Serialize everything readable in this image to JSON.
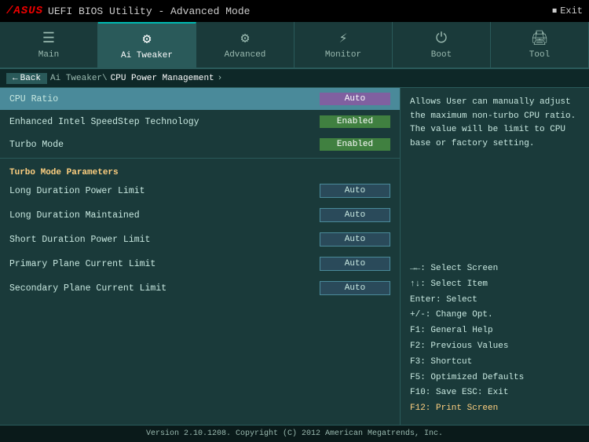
{
  "topbar": {
    "logo": "/ASUS",
    "title": "UEFI BIOS Utility - Advanced Mode",
    "exit_label": "Exit"
  },
  "tabs": [
    {
      "id": "main",
      "label": "Main",
      "icon": "≡",
      "active": false
    },
    {
      "id": "ai-tweaker",
      "label": "Ai Tweaker",
      "icon": "⚙",
      "active": true
    },
    {
      "id": "advanced",
      "label": "Advanced",
      "icon": "⚙",
      "active": false
    },
    {
      "id": "monitor",
      "label": "Monitor",
      "icon": "⚡",
      "active": false
    },
    {
      "id": "boot",
      "label": "Boot",
      "icon": "⏻",
      "active": false
    },
    {
      "id": "tool",
      "label": "Tool",
      "icon": "🖨",
      "active": false
    }
  ],
  "breadcrumb": {
    "back_label": "Back",
    "path1": "Ai Tweaker\\",
    "path2": "CPU Power Management",
    "arrow": "›"
  },
  "settings": [
    {
      "id": "cpu-ratio",
      "label": "CPU Ratio",
      "value": "Auto",
      "style": "purple",
      "highlighted": true
    },
    {
      "id": "speedstep",
      "label": "Enhanced Intel SpeedStep Technology",
      "value": "Enabled",
      "style": "green"
    },
    {
      "id": "turbo-mode",
      "label": "Turbo Mode",
      "value": "Enabled",
      "style": "green"
    },
    {
      "id": "turbo-params-header",
      "label": "Turbo Mode Parameters",
      "type": "section"
    },
    {
      "id": "long-duration-power",
      "label": "Long Duration Power Limit",
      "value": "Auto",
      "style": "auto"
    },
    {
      "id": "long-duration-maintained",
      "label": "Long Duration Maintained",
      "value": "Auto",
      "style": "auto"
    },
    {
      "id": "short-duration-power",
      "label": "Short Duration Power Limit",
      "value": "Auto",
      "style": "auto"
    },
    {
      "id": "primary-plane-current",
      "label": "Primary Plane Current Limit",
      "value": "Auto",
      "style": "auto"
    },
    {
      "id": "secondary-plane-current",
      "label": "Secondary Plane Current Limit",
      "value": "Auto",
      "style": "auto"
    }
  ],
  "help_text": "Allows User can manually adjust the maximum non-turbo CPU ratio. The value will be limit to CPU base or factory setting.",
  "shortcuts": [
    {
      "key": "→←: Select Screen"
    },
    {
      "key": "↑↓: Select Item"
    },
    {
      "key": "Enter: Select"
    },
    {
      "key": "+/-: Change Opt."
    },
    {
      "key": "F1: General Help"
    },
    {
      "key": "F2: Previous Values"
    },
    {
      "key": "F3: Shortcut"
    },
    {
      "key": "F5: Optimized Defaults"
    },
    {
      "key": "F10: Save  ESC: Exit"
    },
    {
      "key": "F12: Print Screen",
      "highlight": true
    }
  ],
  "footer": {
    "text": "Version 2.10.1208. Copyright (C) 2012 American Megatrends, Inc."
  }
}
